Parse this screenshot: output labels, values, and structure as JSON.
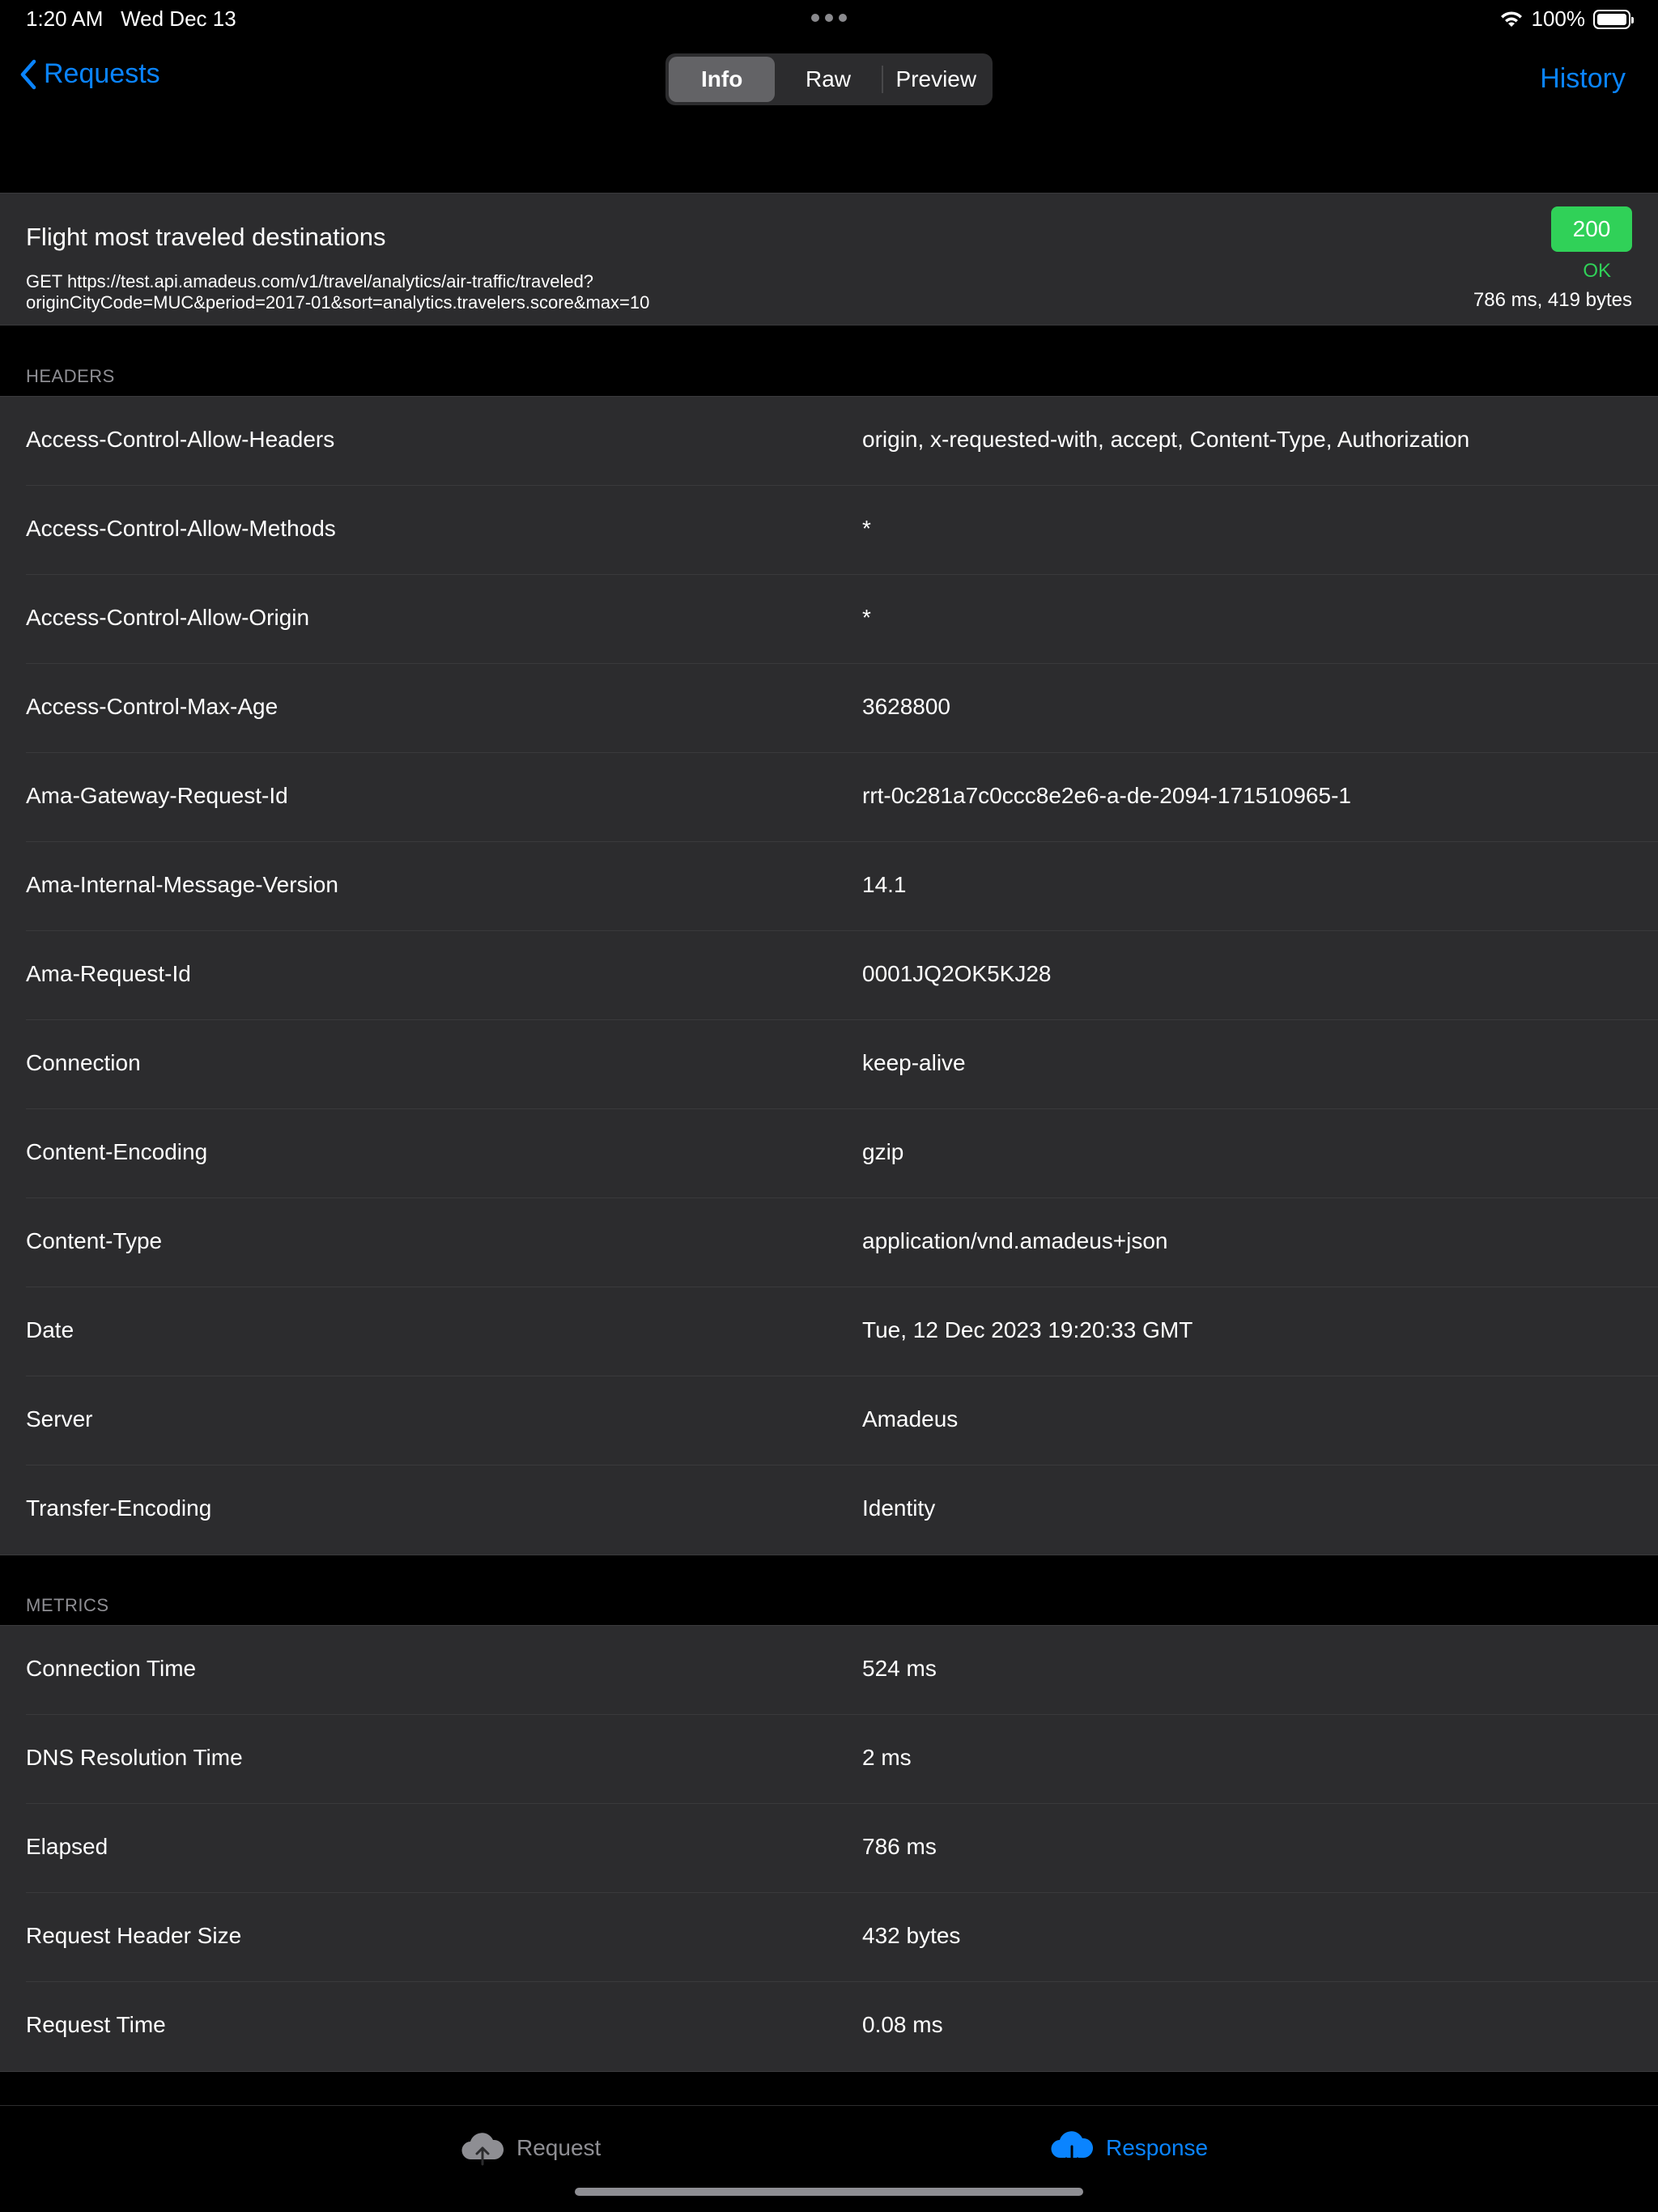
{
  "status_bar": {
    "time": "1:20 AM",
    "date": "Wed Dec 13",
    "battery": "100%"
  },
  "nav": {
    "back_label": "Requests",
    "segments": [
      "Info",
      "Raw",
      "Preview"
    ],
    "active_segment": "Info",
    "history_label": "History"
  },
  "summary": {
    "title": "Flight most traveled destinations",
    "url": "GET https://test.api.amadeus.com/v1/travel/analytics/air-traffic/traveled?originCityCode=MUC&period=2017-01&sort=analytics.travelers.score&max=10",
    "status_code": "200",
    "status_text": "OK",
    "meta": "786 ms, 419 bytes"
  },
  "headers": {
    "section_title": "HEADERS",
    "rows": [
      {
        "key": "Access-Control-Allow-Headers",
        "value": "origin, x-requested-with, accept, Content-Type, Authorization"
      },
      {
        "key": "Access-Control-Allow-Methods",
        "value": "*"
      },
      {
        "key": "Access-Control-Allow-Origin",
        "value": "*"
      },
      {
        "key": "Access-Control-Max-Age",
        "value": "3628800"
      },
      {
        "key": "Ama-Gateway-Request-Id",
        "value": "rrt-0c281a7c0ccc8e2e6-a-de-2094-171510965-1"
      },
      {
        "key": "Ama-Internal-Message-Version",
        "value": "14.1"
      },
      {
        "key": "Ama-Request-Id",
        "value": "0001JQ2OK5KJ28"
      },
      {
        "key": "Connection",
        "value": "keep-alive"
      },
      {
        "key": "Content-Encoding",
        "value": "gzip"
      },
      {
        "key": "Content-Type",
        "value": "application/vnd.amadeus+json"
      },
      {
        "key": "Date",
        "value": "Tue, 12 Dec 2023 19:20:33 GMT"
      },
      {
        "key": "Server",
        "value": "Amadeus"
      },
      {
        "key": "Transfer-Encoding",
        "value": "Identity"
      }
    ]
  },
  "metrics": {
    "section_title": "METRICS",
    "rows": [
      {
        "key": "Connection Time",
        "value": "524 ms"
      },
      {
        "key": "DNS Resolution Time",
        "value": "2 ms"
      },
      {
        "key": "Elapsed",
        "value": "786 ms"
      },
      {
        "key": "Request Header Size",
        "value": "432 bytes"
      },
      {
        "key": "Request Time",
        "value": "0.08 ms"
      }
    ]
  },
  "tabbar": {
    "items": [
      {
        "label": "Request",
        "icon": "cloud-upload-icon",
        "active": false
      },
      {
        "label": "Response",
        "icon": "cloud-download-icon",
        "active": true
      }
    ]
  },
  "colors": {
    "accent": "#0a84ff",
    "success": "#30d158",
    "cell_background": "#2c2c2e",
    "background": "#000000"
  }
}
